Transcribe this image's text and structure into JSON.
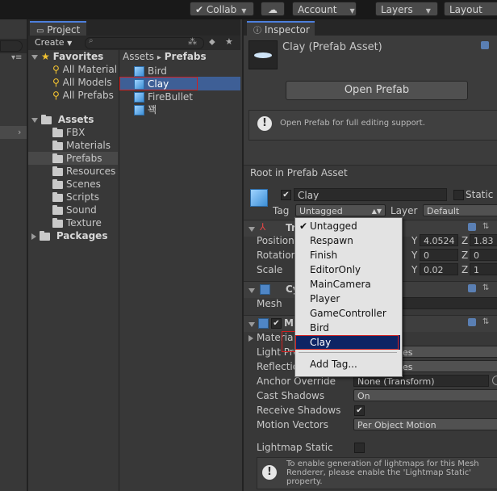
{
  "toolbar": {
    "collab": "Collab",
    "account": "Account",
    "layers": "Layers",
    "layout": "Layout"
  },
  "project": {
    "tab": "Project",
    "create": "Create",
    "favorites": {
      "label": "Favorites",
      "items": [
        "All Material",
        "All Models",
        "All Prefabs"
      ]
    },
    "assets": {
      "label": "Assets",
      "items": [
        "FBX",
        "Materials",
        "Prefabs",
        "Resources",
        "Scenes",
        "Scripts",
        "Sound",
        "Texture"
      ]
    },
    "packages": "Packages",
    "breadcrumb": {
      "root": "Assets",
      "sep": "▸",
      "current": "Prefabs"
    },
    "files": [
      "Bird",
      "Clay",
      "FireBullet",
      "꽥"
    ],
    "selected_file": "Clay"
  },
  "inspector": {
    "tab": "Inspector",
    "asset_title": "Clay (Prefab Asset)",
    "open_prefab": "Open Prefab",
    "help": "Open Prefab for full editing support.",
    "root_label": "Root in Prefab Asset",
    "object_name": "Clay",
    "static_label": "Static",
    "tag_label": "Tag",
    "tag_value": "Untagged",
    "layer_label": "Layer",
    "layer_value": "Default",
    "transform": {
      "header": "Tr",
      "position_label": "Position",
      "rotation_label": "Rotation",
      "scale_label": "Scale",
      "y_label": "Y",
      "z_label": "Z",
      "pos_y": "4.0524",
      "pos_z": "1.83",
      "rot_y": "0",
      "rot_z": "0",
      "scale_y": "0.02",
      "scale_z": "1"
    },
    "mesh_filter": {
      "header": "Cy",
      "mesh_label": "Mesh"
    },
    "mesh_renderer": {
      "header": "M",
      "materials": "Materia",
      "light_probes": "Light Pro",
      "light_probes_value": "es",
      "reflection": "Reflectio",
      "reflection_value": "es",
      "anchor_label": "Anchor Override",
      "anchor_value": "None (Transform)",
      "cast_label": "Cast Shadows",
      "cast_value": "On",
      "receive_label": "Receive Shadows",
      "motion_label": "Motion Vectors",
      "motion_value": "Per Object Motion",
      "lightmap_label": "Lightmap Static",
      "lightmap_help": "To enable generation of lightmaps for this Mesh Renderer, please enable the 'Lightmap Static' property."
    },
    "tag_dropdown": {
      "items": [
        "Untagged",
        "Respawn",
        "Finish",
        "EditorOnly",
        "MainCamera",
        "Player",
        "GameController",
        "Bird",
        "Clay"
      ],
      "checked": "Untagged",
      "highlighted": "Clay",
      "add_tag": "Add Tag..."
    }
  },
  "colors": {
    "selection_blue": "#3e5f96",
    "dropdown_highlight": "#0e2464",
    "annotation_red": "#d02020"
  }
}
